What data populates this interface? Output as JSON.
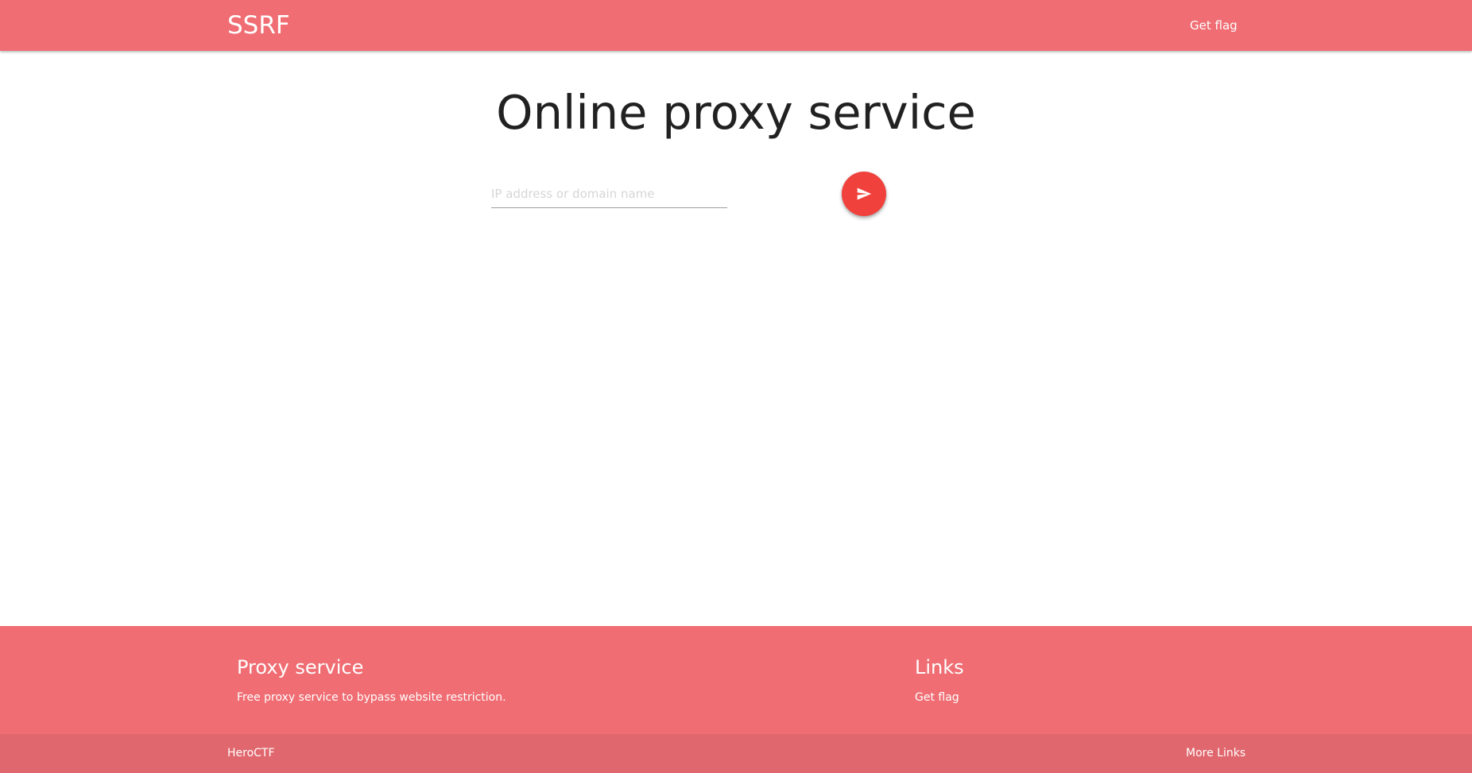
{
  "navbar": {
    "brand": "SSRF",
    "links": [
      {
        "label": "Get flag"
      }
    ]
  },
  "main": {
    "title": "Online proxy service",
    "input": {
      "value": "",
      "placeholder": "IP address or domain name"
    },
    "send_button": {
      "icon": "send-icon"
    }
  },
  "footer": {
    "about": {
      "title": "Proxy service",
      "text": "Free proxy service to bypass website restriction."
    },
    "links": {
      "title": "Links",
      "items": [
        {
          "label": "Get flag"
        }
      ]
    },
    "copyright": {
      "text": "HeroCTF",
      "more_links": "More Links"
    }
  },
  "colors": {
    "primary": "#ef6d73",
    "primary_dark": "#e0676d",
    "accent": "#f0413c",
    "title_text": "#212121",
    "placeholder": "#d6d6d6"
  }
}
